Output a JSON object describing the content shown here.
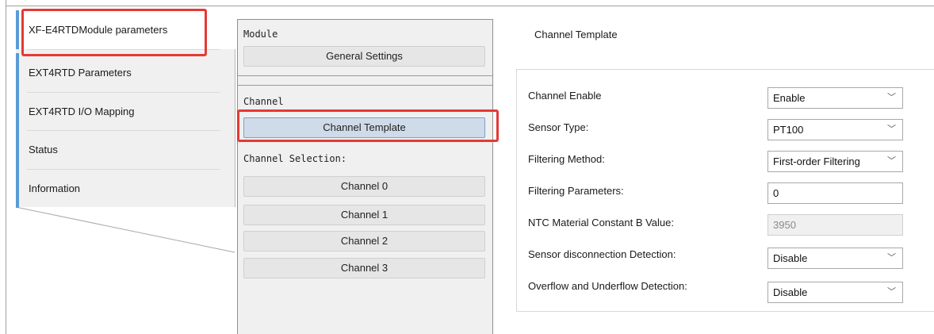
{
  "nav": {
    "items": [
      {
        "label": "XF-E4RTDModule parameters",
        "active": true
      },
      {
        "label": "EXT4RTD Parameters"
      },
      {
        "label": "EXT4RTD I/O Mapping"
      },
      {
        "label": "Status"
      },
      {
        "label": "Information"
      }
    ]
  },
  "middle": {
    "module_label": "Module",
    "general_settings": "General Settings",
    "channel_label": "Channel",
    "channel_template": "Channel Template",
    "channel_selection_label": "Channel Selection:",
    "channels": [
      "Channel 0",
      "Channel 1",
      "Channel 2",
      "Channel 3"
    ]
  },
  "right": {
    "title": "Channel Template",
    "fields": [
      {
        "label": "Channel Enable",
        "value": "Enable",
        "kind": "select"
      },
      {
        "label": "Sensor Type:",
        "value": "PT100",
        "kind": "select"
      },
      {
        "label": "Filtering Method:",
        "value": "First-order Filtering",
        "kind": "select"
      },
      {
        "label": "Filtering Parameters:",
        "value": "0",
        "kind": "input"
      },
      {
        "label": "NTC Material Constant B Value:",
        "value": "3950",
        "kind": "input-disabled"
      },
      {
        "label": "Sensor disconnection Detection:",
        "value": "Disable",
        "kind": "select"
      },
      {
        "label": "Overflow and Underflow Detection:",
        "value": "Disable",
        "kind": "select"
      }
    ]
  },
  "colors": {
    "accent": "#5b9bd5",
    "highlight": "#e53935",
    "selected_button": "#cfdbe8"
  },
  "icons": {
    "dropdown": "chevron-down-icon"
  }
}
